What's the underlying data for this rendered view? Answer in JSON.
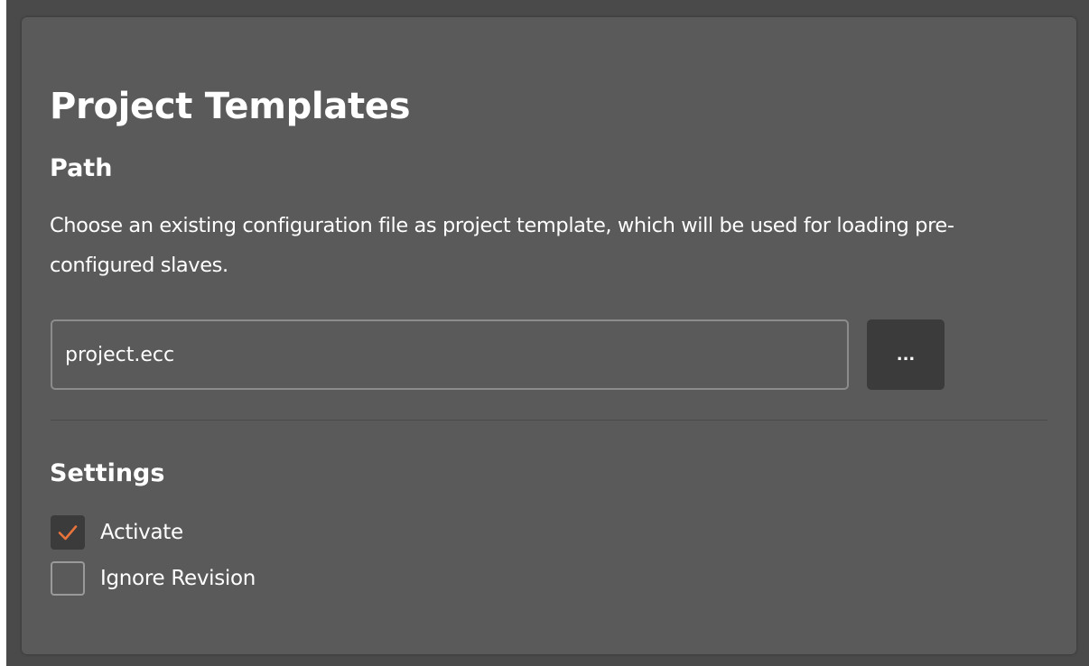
{
  "page": {
    "title": "Project Templates"
  },
  "path_section": {
    "heading": "Path",
    "description": "Choose an existing configuration file as project template, which will be used for loading pre-configured slaves.",
    "input_value": "project.ecc",
    "browse_label": "..."
  },
  "settings_section": {
    "heading": "Settings",
    "options": [
      {
        "label": "Activate",
        "checked": true
      },
      {
        "label": "Ignore Revision",
        "checked": false
      }
    ]
  },
  "colors": {
    "panel_background": "#5a5a5a",
    "outer_background": "#4a4a4a",
    "button_background": "#3b3b3b",
    "checkmark_accent": "#e8743b",
    "text": "#ffffff"
  },
  "icons": {
    "checkmark": "checkmark-icon"
  }
}
